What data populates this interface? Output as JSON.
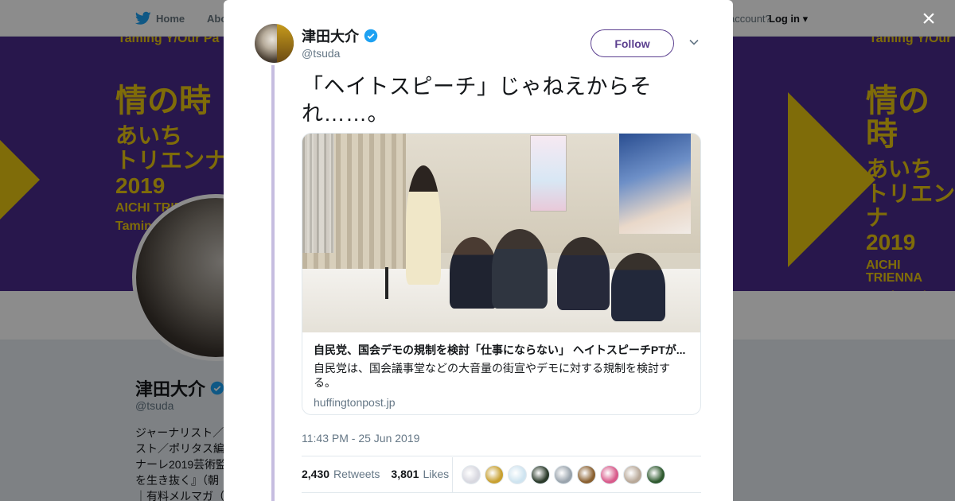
{
  "nav": {
    "home_label": "Home",
    "about_label": "Abo",
    "account_text": "account?",
    "login_label": "Log in"
  },
  "banner": {
    "poster_line1": "情の時",
    "poster_line2": "あいち",
    "poster_line3": "トリエンナ",
    "poster_line4": "2019",
    "poster_line5_left": "AICHI TRIENNA",
    "poster_line6_left": "Taming Y/Our",
    "top_left": "Taming Y/Our Pa",
    "top_right": "Taming Y/Our"
  },
  "profile": {
    "name": "津田大介",
    "handle": "@tsuda",
    "bio_lines": [
      "ジャーナリスト／",
      "スト／ポリタス編",
      "ナーレ2019芸術監",
      "を生き抜く』（朝",
      "｜有料メルマガ（"
    ]
  },
  "tweet": {
    "author_name": "津田大介",
    "author_handle": "@tsuda",
    "follow_label": "Follow",
    "text": "「ヘイトスピーチ」じゃねえからそれ……。",
    "card": {
      "title": "自民党、国会デモの規制を検討「仕事にならない」 ヘイトスピーチPTが...",
      "description": "自民党は、国会議事堂などの大音量の街宣やデモに対する規制を検討する。",
      "domain": "huffingtonpost.jp"
    },
    "timestamp": "11:43 PM - 25 Jun 2019",
    "retweets_count": "2,430",
    "retweets_label": "Retweets",
    "likes_count": "3,801",
    "likes_label": "Likes",
    "liker_colors": [
      "#d8d8e0",
      "#c8a030",
      "#cfe4f0",
      "#2a3a2a",
      "#9aa4ad",
      "#8a6030",
      "#d85a8a",
      "#b8a898",
      "#2f5a2f"
    ]
  },
  "close_label": "×",
  "colors": {
    "accent": "#5b3f8f",
    "thread_line": "#c6bde0",
    "verified": "#1da1f2",
    "banner_purple": "#4a2a8a",
    "banner_yellow": "#e7c512"
  },
  "icons": [
    "twitter-bird-icon",
    "verified-badge-icon",
    "chevron-down-icon",
    "close-icon"
  ]
}
